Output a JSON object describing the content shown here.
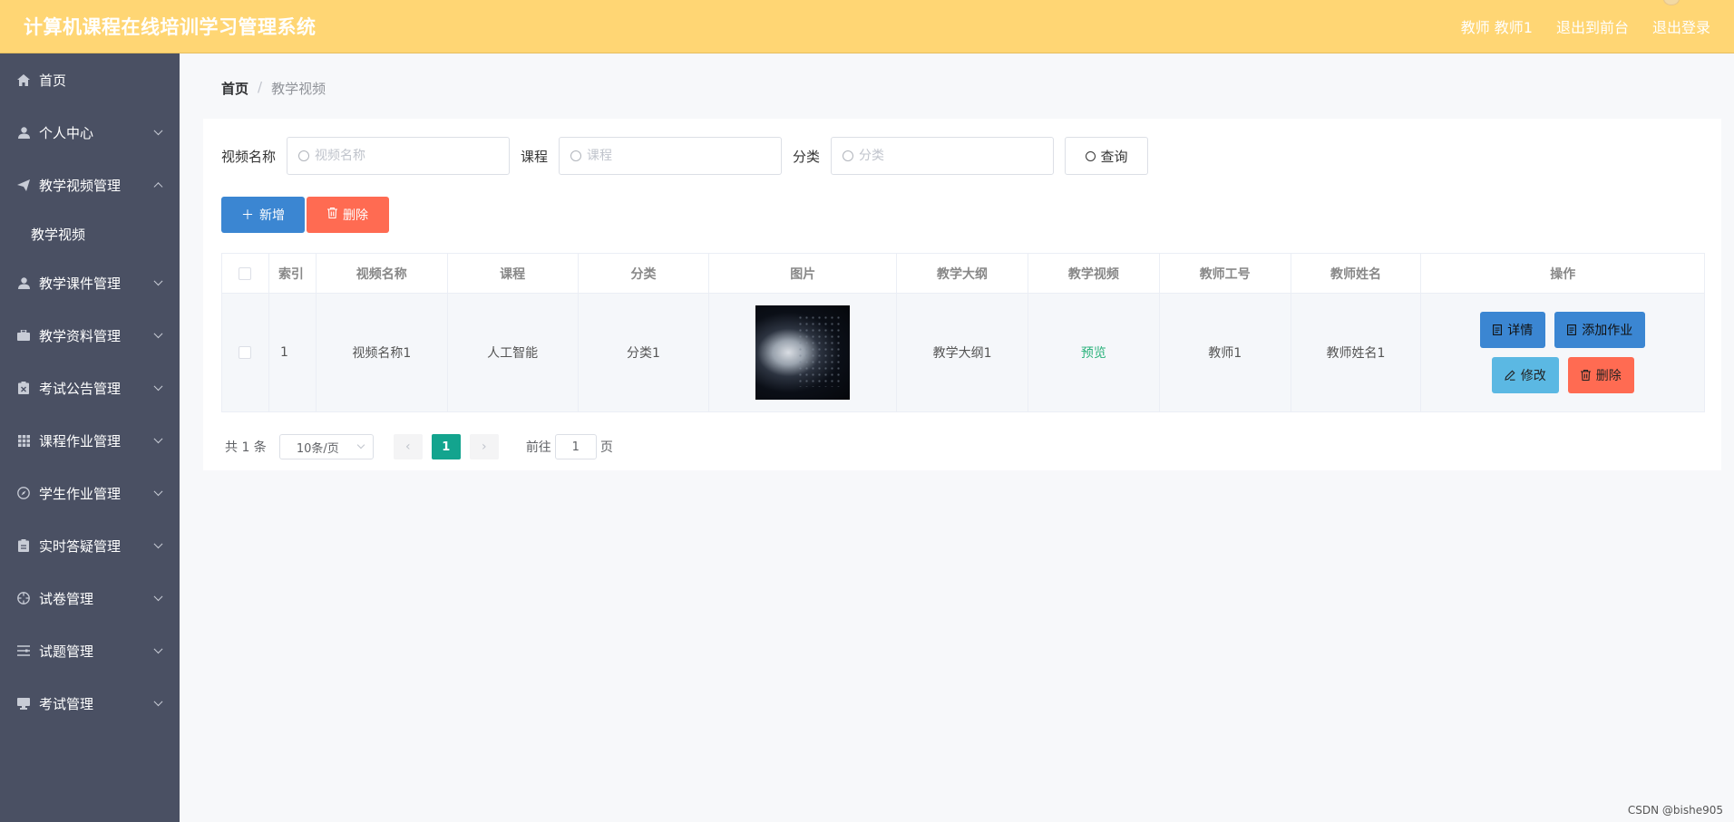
{
  "header": {
    "title": "计算机课程在线培训学习管理系统",
    "user_label": "教师 教师1",
    "front_link": "退出到前台",
    "logout_link": "退出登录"
  },
  "sidebar": {
    "items": [
      {
        "label": "首页",
        "icon": "home-icon",
        "expandable": false
      },
      {
        "label": "个人中心",
        "icon": "user-icon",
        "expandable": true
      },
      {
        "label": "教学视频管理",
        "icon": "paper-plane-icon",
        "expandable": true,
        "expanded": true,
        "children": [
          "教学视频"
        ]
      },
      {
        "label": "教学课件管理",
        "icon": "user-icon",
        "expandable": true
      },
      {
        "label": "教学资料管理",
        "icon": "briefcase-icon",
        "expandable": true
      },
      {
        "label": "考试公告管理",
        "icon": "clipboard-x-icon",
        "expandable": true
      },
      {
        "label": "课程作业管理",
        "icon": "grid-icon",
        "expandable": true
      },
      {
        "label": "学生作业管理",
        "icon": "compass-icon",
        "expandable": true
      },
      {
        "label": "实时答疑管理",
        "icon": "clipboard-icon",
        "expandable": true
      },
      {
        "label": "试卷管理",
        "icon": "crosshair-icon",
        "expandable": true
      },
      {
        "label": "试题管理",
        "icon": "list-icon",
        "expandable": true
      },
      {
        "label": "考试管理",
        "icon": "monitor-icon",
        "expandable": true
      }
    ]
  },
  "breadcrumb": {
    "home": "首页",
    "sep": "/",
    "current": "教学视频"
  },
  "search": {
    "video_name_label": "视频名称",
    "video_name_placeholder": "视频名称",
    "course_label": "课程",
    "course_placeholder": "课程",
    "category_label": "分类",
    "category_placeholder": "分类",
    "query_button": "查询"
  },
  "actions": {
    "add": "新增",
    "delete": "删除"
  },
  "table": {
    "headers": [
      "索引",
      "视频名称",
      "课程",
      "分类",
      "图片",
      "教学大纲",
      "教学视频",
      "教师工号",
      "教师姓名",
      "操作"
    ],
    "rows": [
      {
        "index": "1",
        "video_name": "视频名称1",
        "course": "人工智能",
        "category": "分类1",
        "syllabus": "教学大纲1",
        "video_link": "预览",
        "teacher_id": "教师1",
        "teacher_name": "教师姓名1",
        "ops": {
          "detail": "详情",
          "add_homework": "添加作业",
          "edit": "修改",
          "delete": "删除"
        }
      }
    ]
  },
  "pagination": {
    "total": "共 1 条",
    "page_size": "10条/页",
    "current_page": "1",
    "goto_label": "前往",
    "goto_value": "1",
    "page_suffix": "页"
  },
  "watermark": "CSDN @bishe905",
  "colors": {
    "header": "#ffd674",
    "sidebar": "#4a5063",
    "primary": "#3b86d2",
    "danger": "#ff6b52",
    "info": "#5bb8e3",
    "page_active": "#13a48e",
    "link": "#2ab27b"
  }
}
